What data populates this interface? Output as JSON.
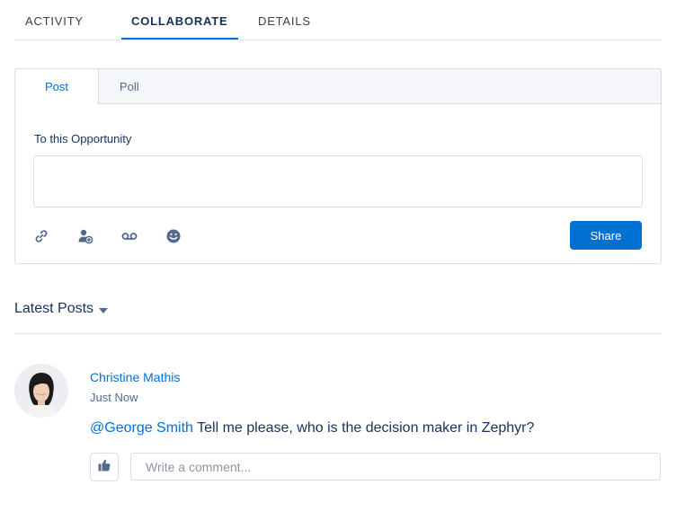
{
  "tabs": [
    {
      "label": "ACTIVITY"
    },
    {
      "label": "COLLABORATE",
      "active": true
    },
    {
      "label": "DETAILS"
    }
  ],
  "publisher": {
    "tabs": [
      {
        "label": "Post",
        "active": true
      },
      {
        "label": "Poll"
      }
    ],
    "to_label": "To this Opportunity",
    "input_value": "",
    "toolbar_icons": [
      "link-icon",
      "mention-user-icon",
      "voicemail-icon",
      "emoji-icon"
    ],
    "share_label": "Share"
  },
  "feed": {
    "sort_label": "Latest Posts",
    "posts": [
      {
        "author": "Christine Mathis",
        "timestamp": "Just Now",
        "mention": "@George Smith",
        "text": " Tell me please, who is the decision maker in Zephyr?",
        "comment_placeholder": "Write a comment..."
      }
    ]
  },
  "colors": {
    "brand": "#0070d2",
    "text": "#16325c",
    "muted": "#54698d",
    "border": "#d8dde6",
    "icon": "#54698d"
  }
}
